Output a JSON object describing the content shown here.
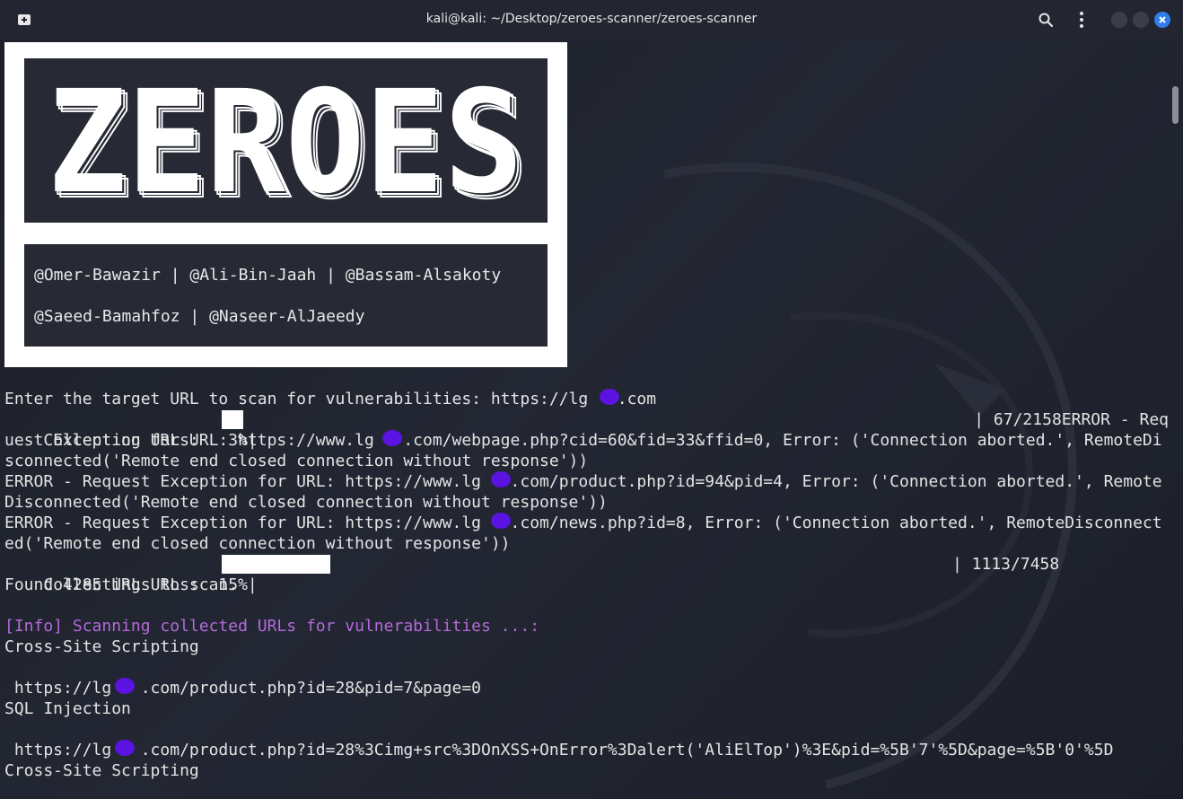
{
  "window": {
    "title": "kali@kali: ~/Desktop/zeroes-scanner/zeroes-scanner",
    "accent": "#2f7ee9"
  },
  "banner": {
    "logo_text": "ZEROES",
    "credits_line1": "@Omer-Bawazir | @Ali-Bin-Jaah | @Bassam-Alsakoty",
    "credits_line2": "@Saeed-Bamahfoz | @Naseer-AlJaeedy"
  },
  "output": {
    "prompt": "Enter the target URL to scan for vulnerabilities: https://lg   .com",
    "collect1_prefix": "Collecting URLs:   3%|",
    "collect1_suffix": "| 67/2158ERROR - Req",
    "err1a": "uest Exception for URL: https://www.lg   .com/webpage.php?cid=60&fid=33&ffid=0, Error: ('Connection aborted.', RemoteDi",
    "err1b": "sconnected('Remote end closed connection without response'))",
    "err2a": "ERROR - Request Exception for URL: https://www.lg   .com/product.php?id=94&pid=4, Error: ('Connection aborted.', Remote",
    "err2b": "Disconnected('Remote end closed connection without response'))",
    "err3a": "ERROR - Request Exception for URL: https://www.lg   .com/news.php?id=8, Error: ('Connection aborted.', RemoteDisconnect",
    "err3b": "ed('Remote end closed connection without response'))",
    "collect2_prefix": "Collecting URLs:  15%|",
    "collect2_suffix": "| 1113/7458",
    "found": "Found 4285 URLs to scan.",
    "info": "[Info] Scanning collected URLs for vulnerabilities ...:",
    "vuln1_type": "Cross-Site Scripting",
    "vuln1_url": " https://lg   .com/product.php?id=28&pid=7&page=0",
    "vuln2_type": "SQL Injection",
    "vuln2_url": " https://lg   .com/product.php?id=28%3Cimg+src%3DOnXSS+OnError%3Dalert('AliElTop')%3E&pid=%5B'7'%5D&page=%5B'0'%5D",
    "vuln3_type": "Cross-Site Scripting"
  },
  "progress": {
    "collect1_fraction": 0.03,
    "collect2_fraction": 0.15
  },
  "colors": {
    "info": "#b36ad9",
    "redaction": "#5a13e0"
  }
}
